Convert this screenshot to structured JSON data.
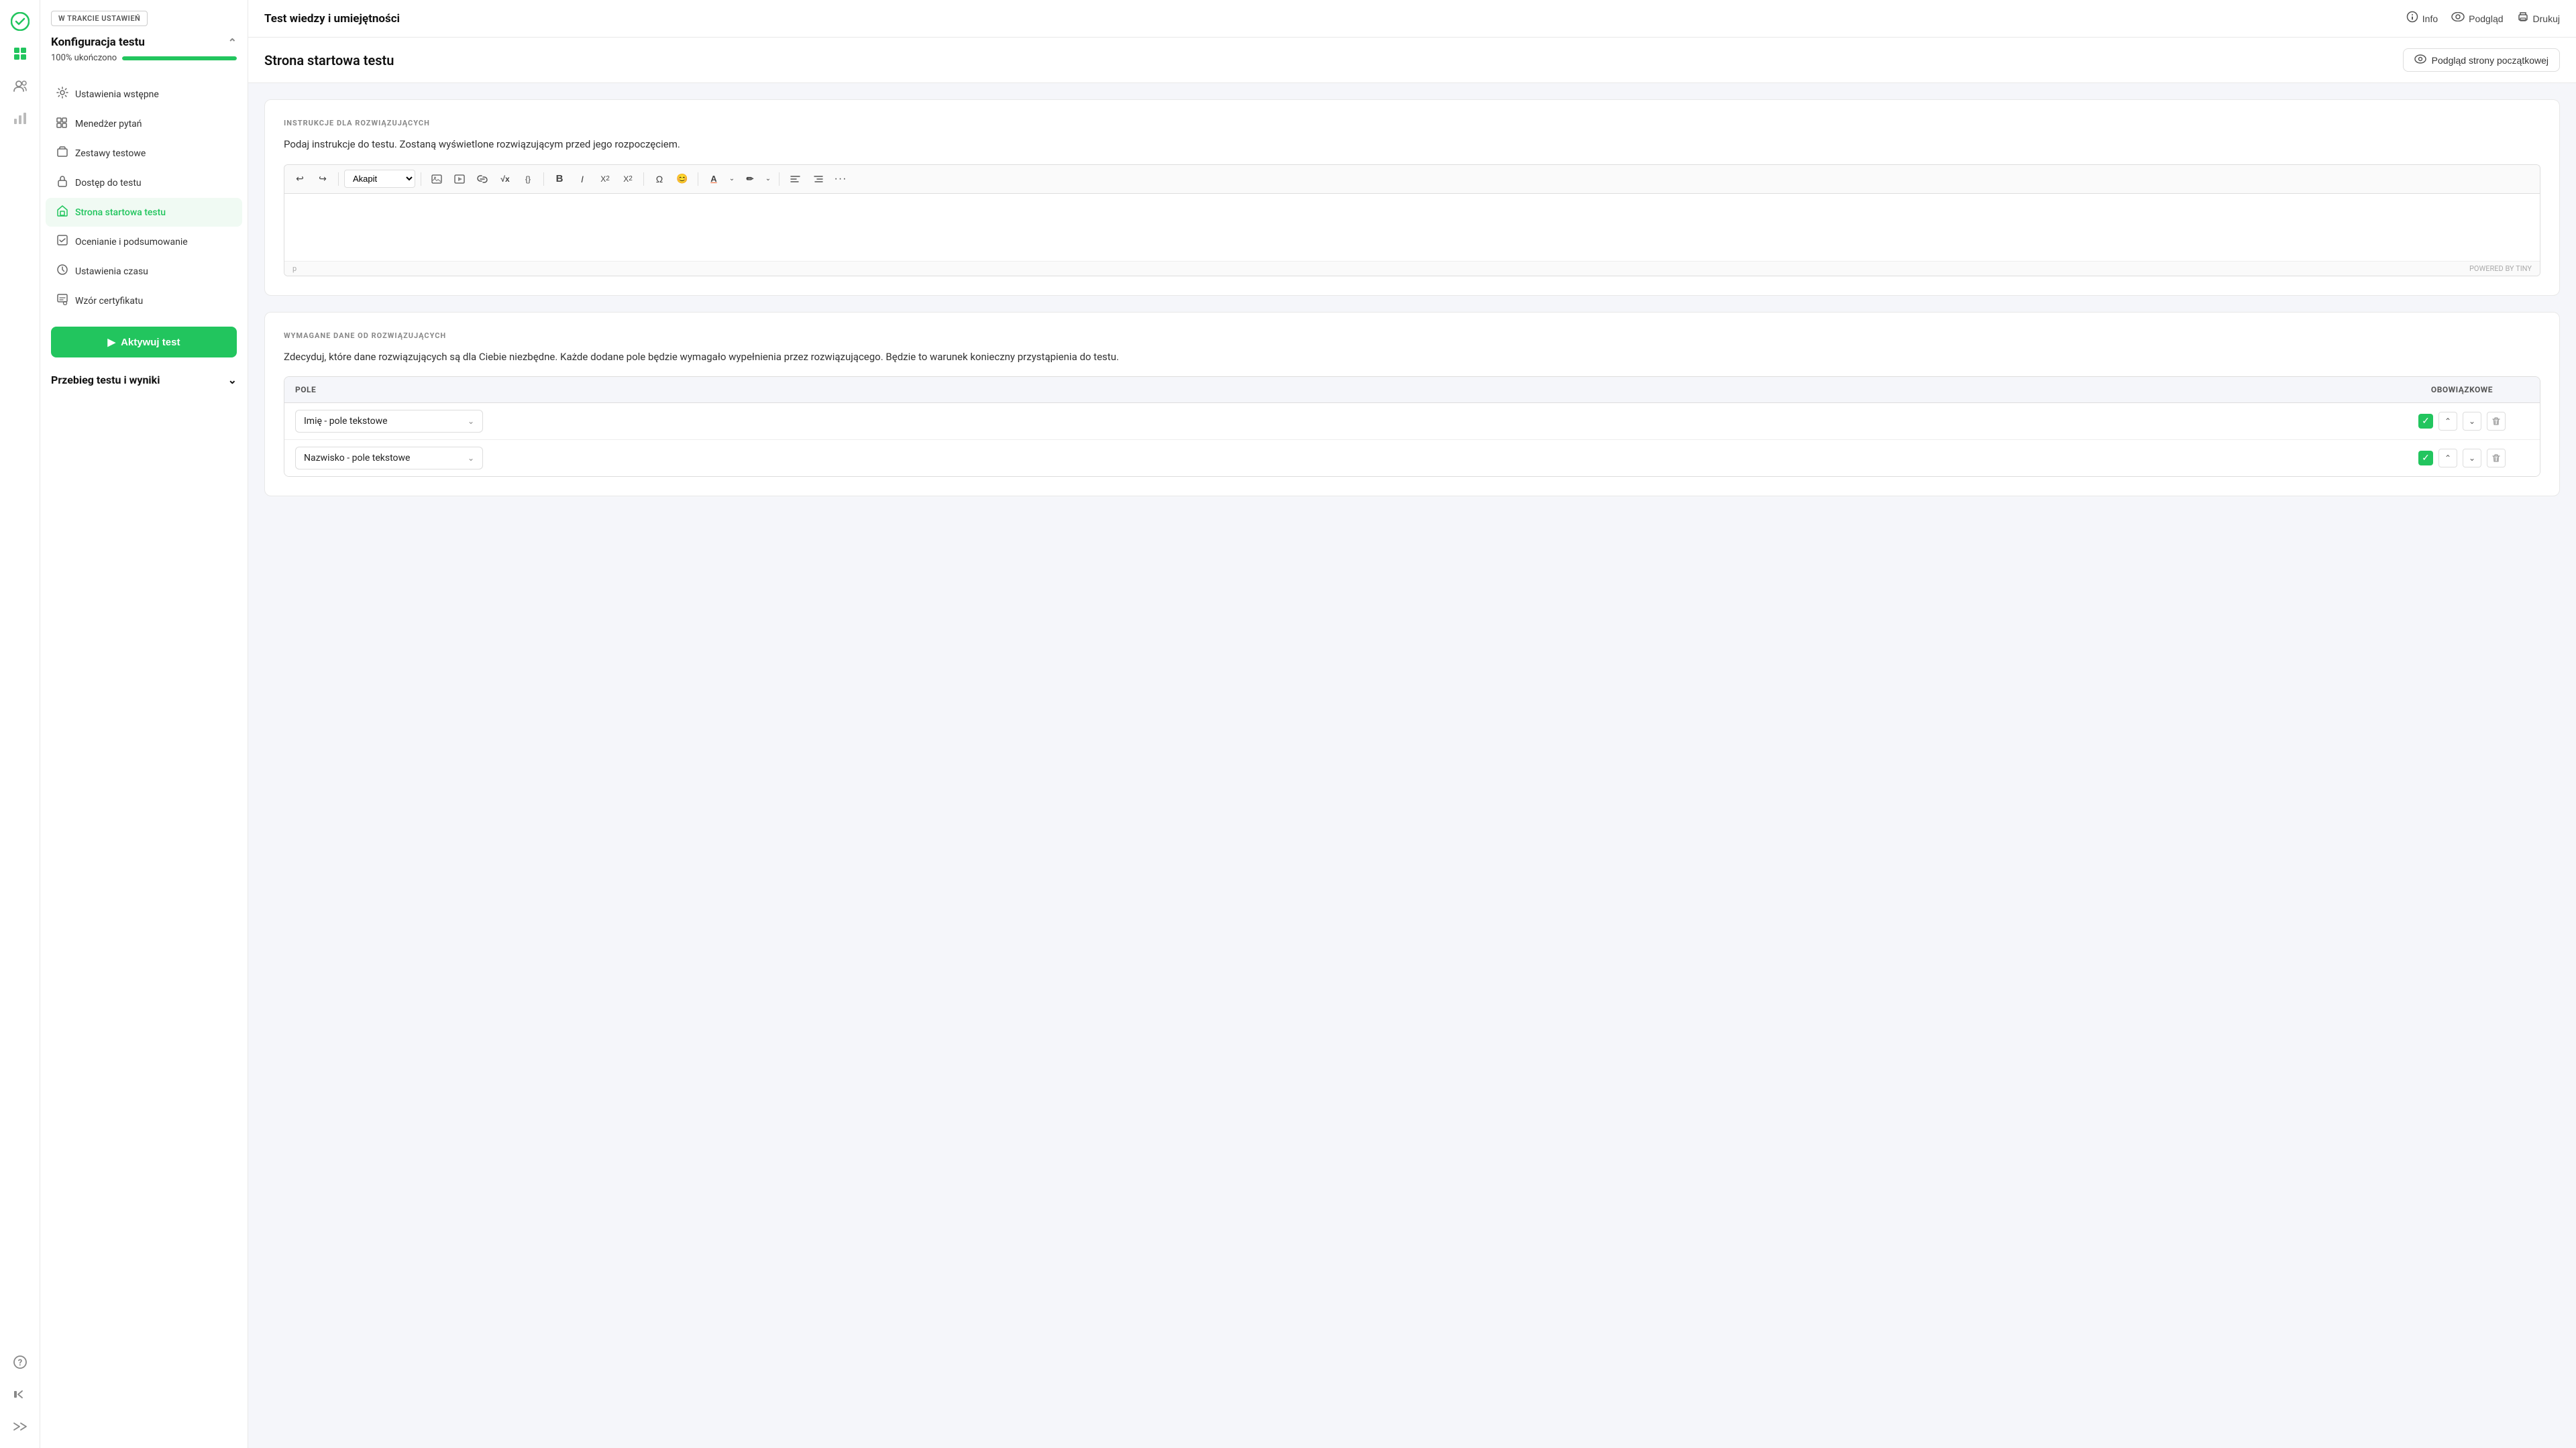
{
  "app": {
    "title": "Test wiedzy i umiejętności"
  },
  "topbar": {
    "info_label": "Info",
    "preview_label": "Podgląd",
    "print_label": "Drukuj"
  },
  "nav_sidebar": {
    "icons": [
      "✓",
      "⊞",
      "👥",
      "📊",
      "⚙"
    ]
  },
  "left_panel": {
    "status_badge": "W TRAKCIE USTAWIEŃ",
    "section1_title": "Konfiguracja testu",
    "progress_label": "100% ukończono",
    "progress_value": 100,
    "menu_items": [
      {
        "id": "ustawienia-wstepne",
        "label": "Ustawienia wstępne",
        "icon": "⚙",
        "active": false
      },
      {
        "id": "menedzer-pytan",
        "label": "Menedżer pytań",
        "icon": "≡",
        "active": false
      },
      {
        "id": "zestawy-testowe",
        "label": "Zestawy testowe",
        "icon": "⊞",
        "active": false
      },
      {
        "id": "dostep-do-testu",
        "label": "Dostęp do testu",
        "icon": "🔒",
        "active": false
      },
      {
        "id": "strona-startowa-testu",
        "label": "Strona startowa testu",
        "icon": "🏠",
        "active": true
      },
      {
        "id": "ocenianie-i-podsumowanie",
        "label": "Ocenianie i podsumowanie",
        "icon": "📋",
        "active": false
      },
      {
        "id": "ustawienia-czasu",
        "label": "Ustawienia czasu",
        "icon": "🕐",
        "active": false
      },
      {
        "id": "wzor-certyfikatu",
        "label": "Wzór certyfikatu",
        "icon": "📜",
        "active": false
      }
    ],
    "activate_btn": "Aktywuj test",
    "section2_title": "Przebieg testu i wyniki"
  },
  "page": {
    "title": "Strona startowa testu",
    "preview_btn": "Podgląd strony początkowej",
    "sections": {
      "instructions": {
        "label": "INSTRUKCJE DLA ROZWIĄZUJĄCYCH",
        "description": "Podaj instrukcje do testu. Zostaną wyświetlone rozwiązującym przed jego rozpoczęciem.",
        "editor_paragraph": "Akapit",
        "editor_footer_left": "p",
        "editor_footer_right": "POWERED BY TINY"
      },
      "required_data": {
        "label": "WYMAGANE DANE OD ROZWIĄZUJĄCYCH",
        "description": "Zdecyduj, które dane rozwiązujących są dla Ciebie niezbędne. Każde dodane pole będzie wymagało wypełnienia przez rozwiązującego. Będzie to warunek konieczny przystąpienia do testu.",
        "table": {
          "col_pole": "POLE",
          "col_obowiazkowe": "OBOWIĄZKOWE",
          "rows": [
            {
              "label": "Imię - pole tekstowe",
              "required": true
            },
            {
              "label": "Nazwisko - pole tekstowe",
              "required": true
            }
          ]
        }
      }
    }
  },
  "toolbar": {
    "buttons": [
      "↩",
      "↪",
      "🖼",
      "▶",
      "🔗",
      "√x",
      "{}",
      "B",
      "I",
      "X₂",
      "X²",
      "Ω",
      "😊",
      "A",
      "✏",
      "≡",
      "≡",
      "..."
    ]
  }
}
